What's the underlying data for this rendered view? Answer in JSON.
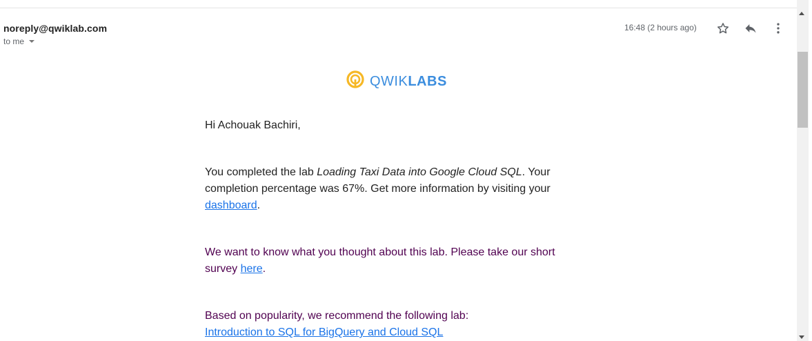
{
  "email": {
    "sender": "noreply@qwiklab.com",
    "recipient": "to me",
    "timestamp": "16:48 (2 hours ago)"
  },
  "logo": {
    "part1": "QWIK",
    "part2": "LABS"
  },
  "body": {
    "greeting": "Hi Achouak Bachiri,",
    "p2_prefix": "You completed the lab ",
    "lab_title": "Loading Taxi Data into Google Cloud SQL",
    "p2_middle": ". Your completion percentage was 67%. Get more information by visiting your ",
    "dashboard_link": "dashboard",
    "p2_suffix": ".",
    "p3_prefix": "We want to know what you thought about this lab. Please take our short survey ",
    "survey_link": "here",
    "p3_suffix": ".",
    "p4_text": "Based on popularity, we recommend the following lab:",
    "recommended_link": "Introduction to SQL for BigQuery and Cloud SQL"
  },
  "icons": {
    "star": "star-icon",
    "reply": "reply-icon",
    "more": "more-vert-icon",
    "logo": "qwiklabs-logo-icon"
  },
  "colors": {
    "link": "#1a73e8",
    "logo_blue": "#3b8dde",
    "logo_yellow": "#f6b826",
    "trimmed_text": "#500050"
  }
}
